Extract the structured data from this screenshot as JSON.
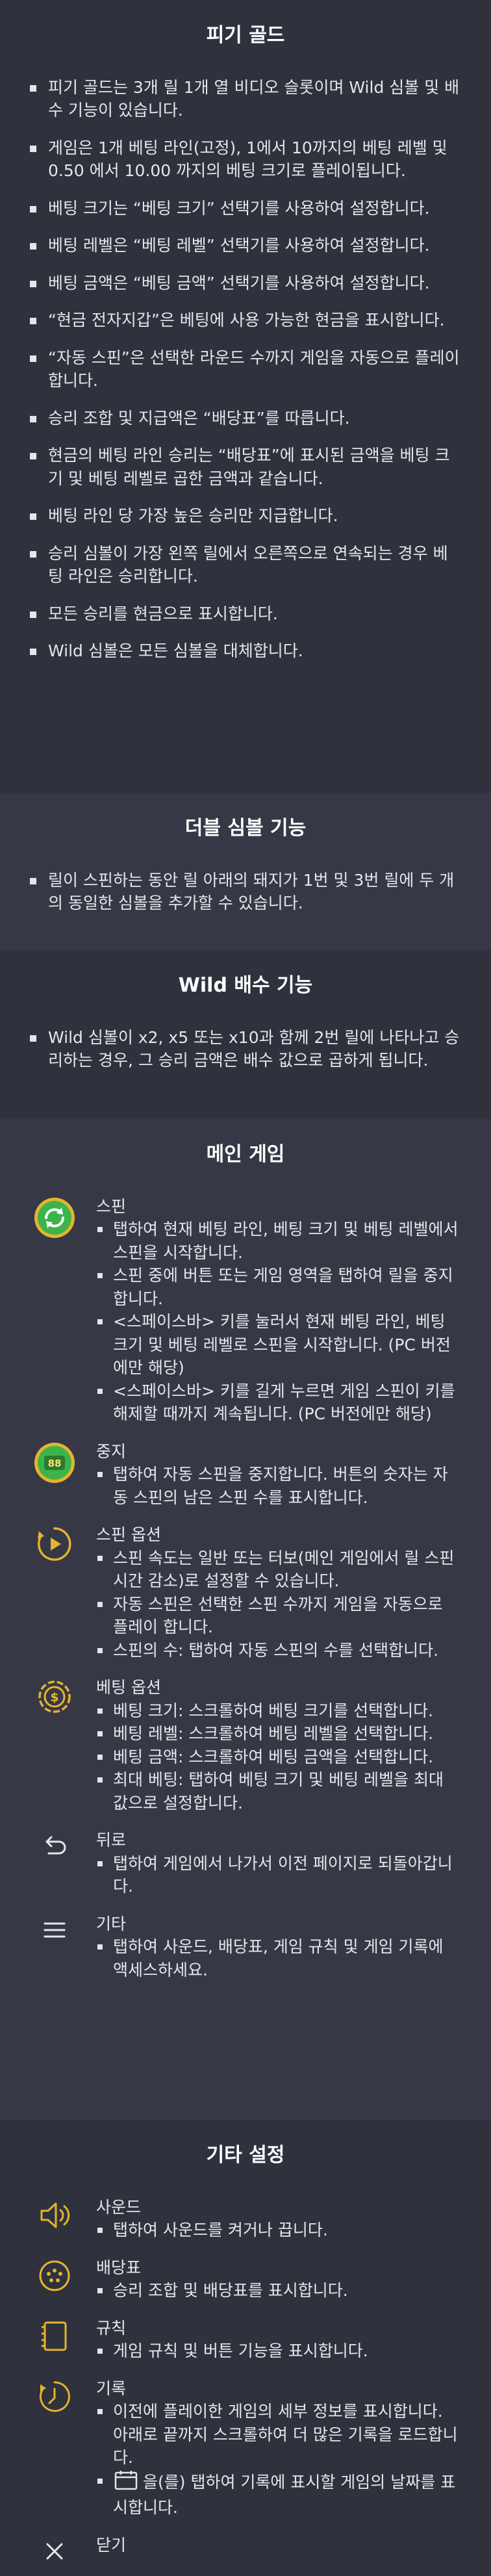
{
  "rules": {
    "title": "피기 골드",
    "items": [
      "피기 골드는 3개 릴 1개 열 비디오 슬롯이며 Wild 심볼 및 배수 기능이 있습니다.",
      "게임은 1개 베팅 라인(고정), 1에서 10까지의 베팅 레벨 및 0.50 에서 10.00 까지의 베팅 크기로 플레이됩니다.",
      "베팅 크기는 “베팅 크기” 선택기를 사용하여 설정합니다.",
      "베팅 레벨은 “베팅 레벨” 선택기를 사용하여 설정합니다.",
      "베팅 금액은 “베팅 금액” 선택기를 사용하여 설정합니다.",
      "“현금 전자지갑”은 베팅에 사용 가능한 현금을 표시합니다.",
      "“자동 스핀”은 선택한 라운드 수까지 게임을 자동으로 플레이합니다.",
      "승리 조합 및 지급액은 “배당표”를 따릅니다.",
      "현금의 베팅 라인 승리는 “배당표”에 표시된 금액을 베팅 크기 및 베팅 레벨로 곱한 금액과 같습니다.",
      "베팅 라인 당 가장 높은 승리만 지급합니다.",
      "승리 심볼이 가장 왼쪽 릴에서 오른쪽으로 연속되는 경우 베팅 라인은 승리합니다.",
      "모든 승리를 현금으로 표시합니다.",
      "Wild 심볼은 모든 심볼을 대체합니다."
    ]
  },
  "double": {
    "title": "더블 심볼 기능",
    "items": [
      "릴이 스핀하는 동안 릴 아래의 돼지가 1번 및 3번 릴에 두 개의 동일한 심볼을 추가할 수 있습니다."
    ]
  },
  "wild": {
    "title": "Wild 배수 기능",
    "items": [
      "Wild 심볼이 x2, x5 또는 x10과 함께 2번 릴에 나타나고 승리하는 경우, 그 승리 금액은 배수 값으로 곱하게 됩니다."
    ]
  },
  "main": {
    "title": "메인 게임",
    "colors": {
      "green": "#3cb44a",
      "gold": "#e7b32e"
    },
    "controls": [
      {
        "icon": "spin-icon",
        "name": "스핀",
        "lines": [
          "탭하여 현재 베팅 라인, 베팅 크기 및 베팅 레벨에서 스핀을 시작합니다.",
          "스핀 중에 버튼 또는 게임 영역을 탭하여 릴을 중지합니다.",
          "<스페이스바> 키를 눌러서 현재 베팅 라인, 베팅 크기 및 베팅 레벨로 스핀을 시작합니다. (PC 버전에만 해당)",
          "<스페이스바> 키를 길게 누르면 게임 스핀이 키를 해제할 때까지 계속됩니다. (PC 버전에만 해당)"
        ]
      },
      {
        "icon": "stop-icon",
        "icon_label": "88",
        "name": "중지",
        "lines": [
          "탭하여 자동 스핀을 중지합니다. 버튼의 숫자는 자동 스핀의 남은 스핀 수를 표시합니다."
        ]
      },
      {
        "icon": "spin-options-icon",
        "name": "스핀 옵션",
        "lines": [
          "스핀 속도는 일반 또는 터보(메인 게임에서 릴 스핀 시간 감소)로 설정할 수 있습니다.",
          "자동 스핀은 선택한 스핀 수까지 게임을 자동으로 플레이 합니다.",
          "스핀의 수: 탭하여 자동 스핀의 수를 선택합니다."
        ]
      },
      {
        "icon": "bet-options-icon",
        "name": "베팅 옵션",
        "lines": [
          "베팅 크기: 스크롤하여 베팅 크기를 선택합니다.",
          "베팅 레벨: 스크롤하여 베팅 레벨을 선택합니다.",
          "베팅 금액: 스크롤하여 베팅 금액을 선택합니다.",
          "최대 베팅: 탭하여 베팅 크기 및 베팅 레벨을 최대 값으로 설정합니다."
        ]
      },
      {
        "icon": "back-icon",
        "name": "뒤로",
        "lines": [
          "탭하여 게임에서 나가서 이전 페이지로 되돌아갑니다."
        ]
      },
      {
        "icon": "menu-icon",
        "name": "기타",
        "lines": [
          "탭하여 사운드, 배당표, 게임 규칙 및 게임 기록에 액세스하세요."
        ]
      }
    ]
  },
  "other": {
    "title": "기타 설정",
    "controls": [
      {
        "icon": "sound-icon",
        "name": "사운드",
        "lines": [
          "탭하여 사운드를 켜거나 끕니다."
        ]
      },
      {
        "icon": "paytable-icon",
        "name": "배당표",
        "lines": [
          "승리 조합 및 배당표를 표시합니다."
        ]
      },
      {
        "icon": "rules-icon",
        "name": "규칙",
        "lines": [
          "게임 규칙 및 버튼 기능을 표시합니다."
        ]
      },
      {
        "icon": "history-icon",
        "name": "기록",
        "lines": [
          "이전에 플레이한 게임의 세부 정보를 표시합니다. 아래로 끝까지 스크롤하여 더 많은 기록을 로드합니다.",
          "을(를) 탭하여 기록에 표시할 게임의 날짜를 표시합니다."
        ]
      },
      {
        "icon": "close-icon",
        "name": "닫기",
        "lines": []
      }
    ]
  }
}
